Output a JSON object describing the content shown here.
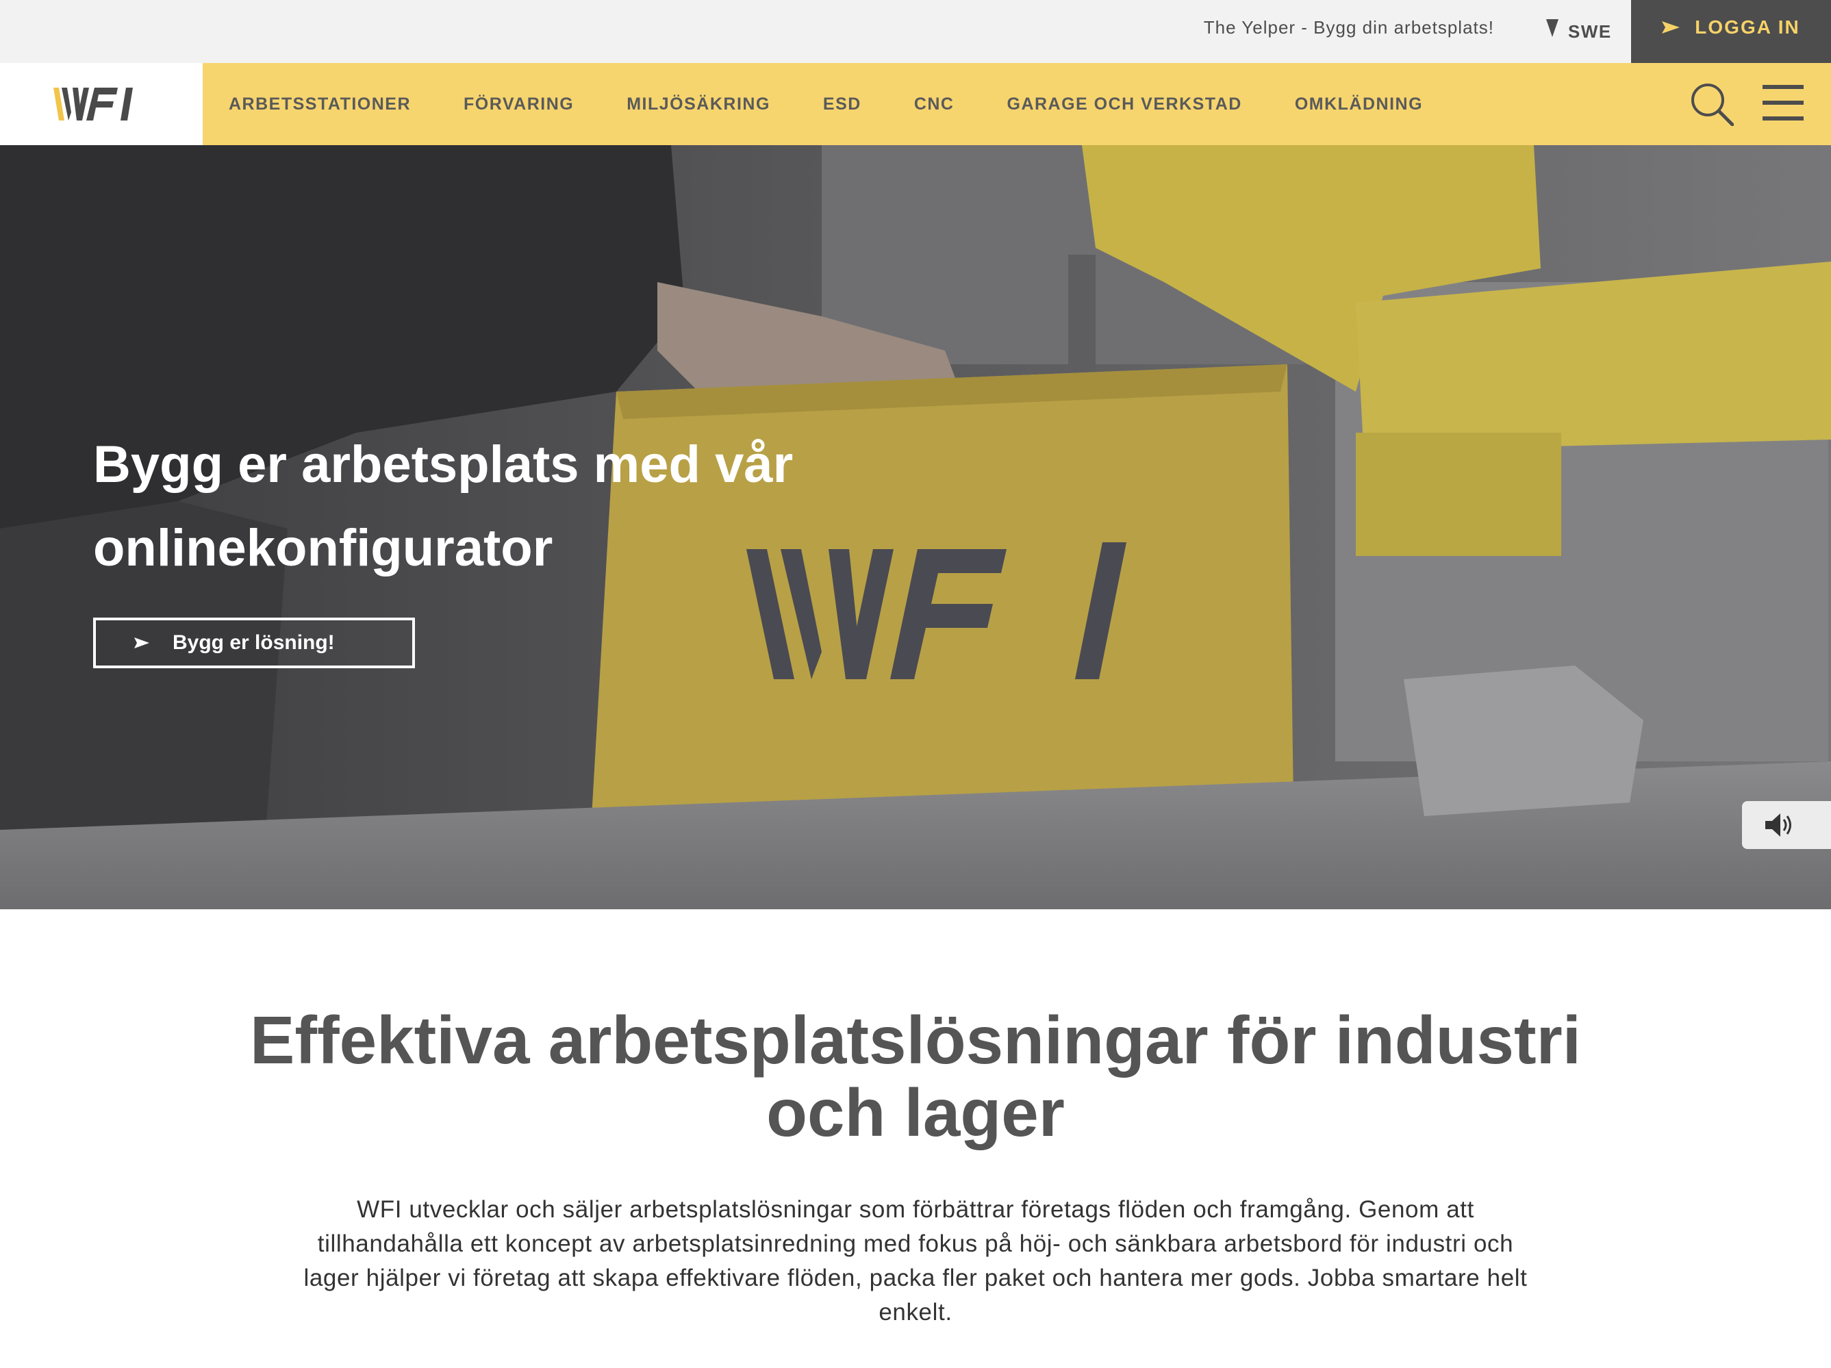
{
  "topbar": {
    "tagline": "The Yelper - Bygg din arbetsplats!",
    "language": "SWE",
    "login_label": "LOGGA IN"
  },
  "brand": {
    "logo_text": "WFI"
  },
  "nav": {
    "items": [
      {
        "label": "ARBETSSTATIONER"
      },
      {
        "label": "FÖRVARING"
      },
      {
        "label": "MILJÖSÄKRING"
      },
      {
        "label": "ESD"
      },
      {
        "label": "CNC"
      },
      {
        "label": "GARAGE OCH VERKSTAD"
      },
      {
        "label": "OMKLÄDNING"
      }
    ],
    "search_icon": "search-icon",
    "menu_icon": "hamburger-menu-icon"
  },
  "hero": {
    "title": "Bygg er arbetsplats med vår onlinekonfigurator",
    "cta_label": "Bygg er lösning!",
    "box_logo_text": "WFI",
    "sound_icon": "sound-on-icon"
  },
  "intro": {
    "heading": "Effektiva arbetsplatslösningar för industri och lager",
    "body": "WFI utvecklar och säljer arbetsplatslösningar som förbättrar företags flöden och framgång. Genom att tillhandahålla ett koncept av arbetsplatsinredning med fokus på höj- och sänkbara arbetsbord för industri och lager hjälper vi företag att skapa effektivare flöden, packa fler paket och hantera mer gods. Jobba smartare helt enkelt."
  },
  "colors": {
    "accent_yellow": "#f7d56e",
    "dark_gray": "#4d4d4d",
    "login_text": "#f7d268",
    "heading_gray": "#555555"
  }
}
